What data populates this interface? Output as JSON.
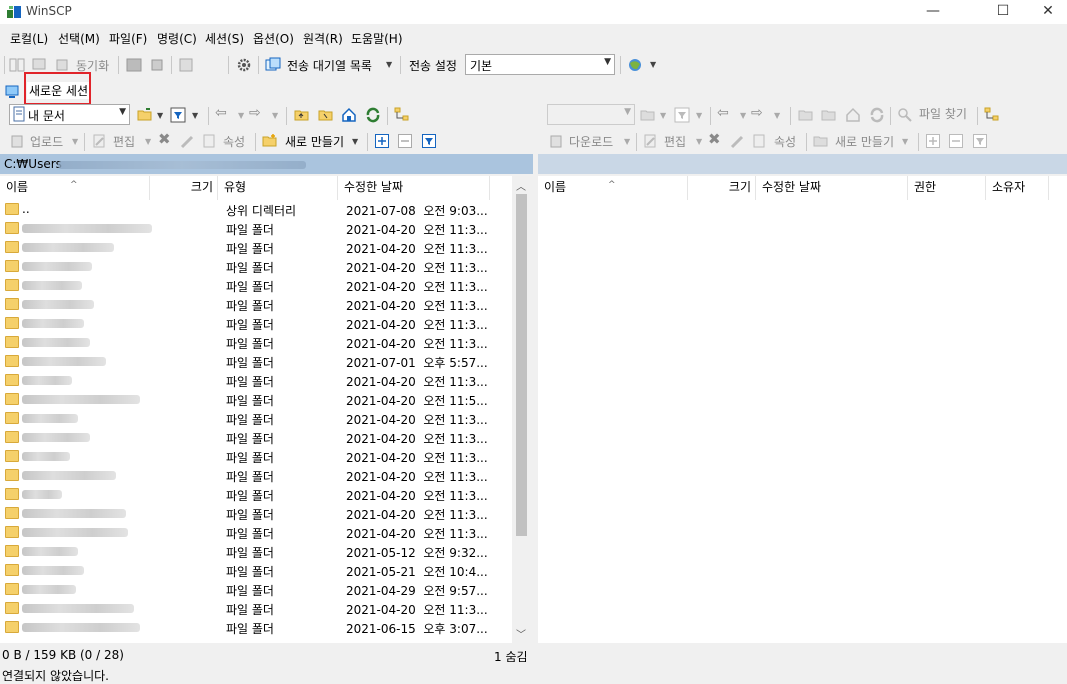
{
  "window": {
    "title": "WinSCP",
    "minimize": "—",
    "maximize": "☐",
    "close": "✕"
  },
  "menu": [
    "로컬(L)",
    "선택(M)",
    "파일(F)",
    "명령(C)",
    "세션(S)",
    "옵션(O)",
    "원격(R)",
    "도움말(H)"
  ],
  "toolbar": {
    "sync_label": "동기화",
    "queue_label": "전송 대기열 목록",
    "transfer_settings_label": "전송 설정",
    "transfer_preset_value": "기본"
  },
  "session_tab": {
    "label": "새로운 세션"
  },
  "local": {
    "drive_value": "내 문서",
    "path": "C:₩Users",
    "actions": {
      "upload": "업로드",
      "edit": "편집",
      "properties": "속성",
      "new": "새로 만들기"
    },
    "columns": {
      "name": "이름",
      "size": "크기",
      "type": "유형",
      "modified": "수정한 날짜"
    },
    "rows": [
      {
        "name": "..",
        "type": "상위 디렉터리",
        "date": "2021-07-08  오전 9:03..."
      },
      {
        "name": "",
        "type": "파일 폴더",
        "date": "2021-04-20  오전 11:3..."
      },
      {
        "name": "",
        "type": "파일 폴더",
        "date": "2021-04-20  오전 11:3..."
      },
      {
        "name": "",
        "type": "파일 폴더",
        "date": "2021-04-20  오전 11:3..."
      },
      {
        "name": "",
        "type": "파일 폴더",
        "date": "2021-04-20  오전 11:3..."
      },
      {
        "name": "",
        "type": "파일 폴더",
        "date": "2021-04-20  오전 11:3..."
      },
      {
        "name": "",
        "type": "파일 폴더",
        "date": "2021-04-20  오전 11:3..."
      },
      {
        "name": "",
        "type": "파일 폴더",
        "date": "2021-04-20  오전 11:3..."
      },
      {
        "name": "",
        "type": "파일 폴더",
        "date": "2021-07-01  오후 5:57..."
      },
      {
        "name": "",
        "type": "파일 폴더",
        "date": "2021-04-20  오전 11:3..."
      },
      {
        "name": "",
        "type": "파일 폴더",
        "date": "2021-04-20  오전 11:5..."
      },
      {
        "name": "",
        "type": "파일 폴더",
        "date": "2021-04-20  오전 11:3..."
      },
      {
        "name": "",
        "type": "파일 폴더",
        "date": "2021-04-20  오전 11:3..."
      },
      {
        "name": "",
        "type": "파일 폴더",
        "date": "2021-04-20  오전 11:3..."
      },
      {
        "name": "",
        "type": "파일 폴더",
        "date": "2021-04-20  오전 11:3..."
      },
      {
        "name": "",
        "type": "파일 폴더",
        "date": "2021-04-20  오전 11:3..."
      },
      {
        "name": "",
        "type": "파일 폴더",
        "date": "2021-04-20  오전 11:3..."
      },
      {
        "name": "",
        "type": "파일 폴더",
        "date": "2021-04-20  오전 11:3..."
      },
      {
        "name": "",
        "type": "파일 폴더",
        "date": "2021-05-12  오전 9:32..."
      },
      {
        "name": "",
        "type": "파일 폴더",
        "date": "2021-05-21  오전 10:4..."
      },
      {
        "name": "",
        "type": "파일 폴더",
        "date": "2021-04-29  오전 9:57..."
      },
      {
        "name": "",
        "type": "파일 폴더",
        "date": "2021-04-20  오전 11:3..."
      },
      {
        "name": "",
        "type": "파일 폴더",
        "date": "2021-06-15  오후 3:07..."
      }
    ],
    "status": "0 B / 159 KB (0 / 28)",
    "hidden": "1 숨김"
  },
  "remote": {
    "find_files": "파일 찾기",
    "actions": {
      "download": "다운로드",
      "edit": "편집",
      "properties": "속성",
      "new": "새로 만들기"
    },
    "columns": {
      "name": "이름",
      "size": "크기",
      "modified": "수정한 날짜",
      "rights": "권한",
      "owner": "소유자"
    }
  },
  "status_bar": {
    "connection": "연결되지 않았습니다."
  },
  "colors": {
    "path_active": "#aac4de",
    "path_inactive": "#c9d7e6",
    "folder": "#f5d06a",
    "highlight": "#e0242a"
  }
}
